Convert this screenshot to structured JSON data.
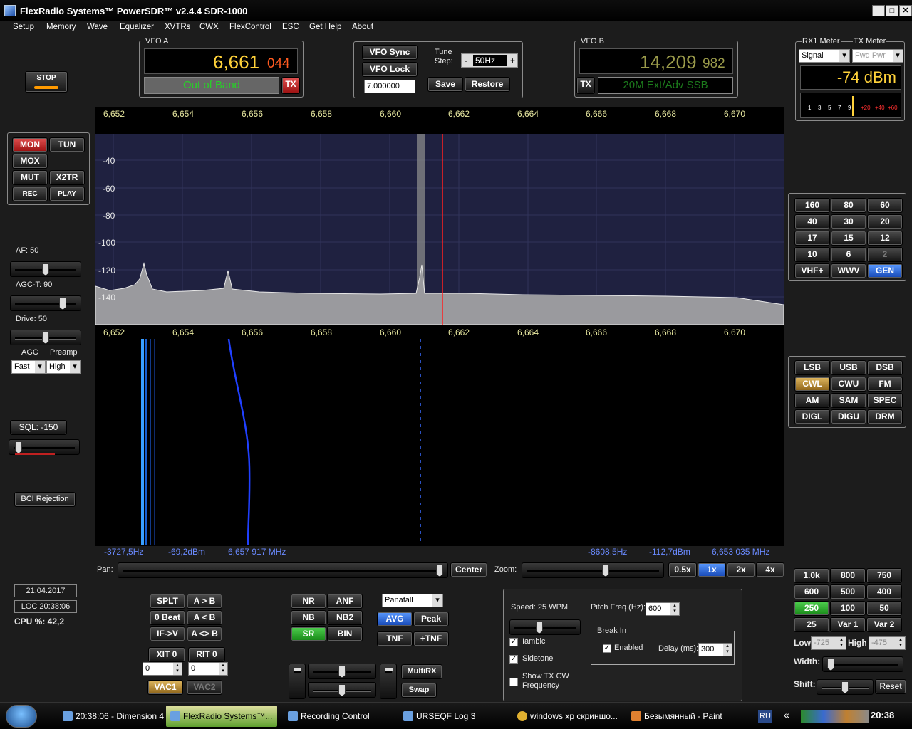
{
  "window": {
    "title": "FlexRadio Systems™  PowerSDR™  v2.4.4   SDR-1000"
  },
  "menu": [
    "Setup",
    "Memory",
    "Wave",
    "Equalizer",
    "XVTRs",
    "CWX",
    "FlexControl",
    "ESC",
    "Get Help",
    "About"
  ],
  "stop_label": "STOP",
  "vfo_a": {
    "label": "VFO A",
    "freq_main": "6,661",
    "freq_sub": "044",
    "band_status": "Out of Band",
    "tx_label": "TX"
  },
  "vfo_center": {
    "sync": "VFO Sync",
    "lock": "VFO Lock",
    "tune_label": "Tune\nStep:",
    "tune_value": "50Hz",
    "minus": "-",
    "plus": "+",
    "mem_freq": "7.000000",
    "save": "Save",
    "restore": "Restore"
  },
  "vfo_b": {
    "label": "VFO B",
    "freq_main": "14,209",
    "freq_sub": "982",
    "tx_label": "TX",
    "band_status": "20M Ext/Adv SSB"
  },
  "meter": {
    "rx_label": "RX1 Meter",
    "tx_label": "TX Meter",
    "rx_select": "Signal",
    "tx_select": "Fwd Pwr",
    "reading": "-74 dBm",
    "scale": [
      "1",
      "3",
      "5",
      "7",
      "9",
      "+20",
      "+40",
      "+60"
    ]
  },
  "left_buttons": {
    "mon": "MON",
    "tun": "TUN",
    "mox": "MOX",
    "mut": "MUT",
    "x2tr": "X2TR",
    "rec": "REC",
    "play": "PLAY"
  },
  "af_label": "AF:  50",
  "agct_label": "AGC-T:  90",
  "drive_label": "Drive:  50",
  "agc_label": "AGC",
  "preamp_label": "Preamp",
  "agc_value": "Fast",
  "preamp_value": "High",
  "sql_label": "SQL:  -150",
  "bci_label": "BCI Rejection",
  "date": "21.04.2017",
  "loc_time": "LOC 20:38:06",
  "cpu": "CPU %: 42,2",
  "freq_axis": [
    "6,652",
    "6,654",
    "6,656",
    "6,658",
    "6,660",
    "6,662",
    "6,664",
    "6,666",
    "6,668",
    "6,670"
  ],
  "db_axis": [
    "-40",
    "-60",
    "-80",
    "-100",
    "-120",
    "-140"
  ],
  "cursor_left": {
    "offset": "-3727,5Hz",
    "level": "-69,2dBm",
    "freq": "6,657 917 MHz"
  },
  "cursor_right": {
    "offset": "-8608,5Hz",
    "level": "-112,7dBm",
    "freq": "6,653 035 MHz"
  },
  "pan_label": "Pan:",
  "center_label": "Center",
  "zoom_label": "Zoom:",
  "zoom_buttons": [
    "0.5x",
    "1x",
    "2x",
    "4x"
  ],
  "bands": [
    "160",
    "80",
    "60",
    "40",
    "30",
    "20",
    "17",
    "15",
    "12",
    "10",
    "6",
    "2",
    "VHF+",
    "WWV",
    "GEN"
  ],
  "modes": [
    "LSB",
    "USB",
    "DSB",
    "CWL",
    "CWU",
    "FM",
    "AM",
    "SAM",
    "SPEC",
    "DIGL",
    "DIGU",
    "DRM"
  ],
  "filters": [
    "1.0k",
    "800",
    "750",
    "600",
    "500",
    "400",
    "250",
    "100",
    "50",
    "25",
    "Var 1",
    "Var 2"
  ],
  "filter_low_label": "Low",
  "filter_low": "-725",
  "filter_high_label": "High",
  "filter_high": "-475",
  "width_label": "Width:",
  "shift_label": "Shift:",
  "reset_label": "Reset",
  "bottom_left": {
    "splt": "SPLT",
    "atob": "A > B",
    "zerobeat": "0 Beat",
    "btoa": "A < B",
    "ifv": "IF->V",
    "swap_ab": "A <> B",
    "xit": "XIT",
    "xit_val": "0",
    "rit": "RIT",
    "rit_val": "0",
    "xit_field": "0",
    "rit_field": "0",
    "vac1": "VAC1",
    "vac2": "VAC2"
  },
  "dsp": {
    "nr": "NR",
    "anf": "ANF",
    "nb": "NB",
    "nb2": "NB2",
    "sr": "SR",
    "bin": "BIN",
    "display_mode": "Panafall",
    "avg": "AVG",
    "peak": "Peak",
    "tnf": "TNF",
    "plus_tnf": "+TNF"
  },
  "multirx": "MultiRX",
  "swap": "Swap",
  "cw": {
    "speed": "Speed:  25 WPM",
    "pitch_label": "Pitch Freq (Hz):",
    "pitch": "600",
    "iambic": "Iambic",
    "sidetone": "Sidetone",
    "show_tx": "Show TX CW\nFrequency",
    "breakin": "Break In",
    "enabled": "Enabled",
    "delay_label": "Delay (ms):",
    "delay": "300"
  },
  "taskbar": {
    "items": [
      "20:38:06 - Dimension 4",
      "FlexRadio Systems™...",
      "Recording Control",
      "URSEQF Log 3",
      "windows xp скриншо...",
      "Безымянный - Paint"
    ],
    "lang": "RU",
    "clock": "20:38"
  },
  "colors": {
    "accent_yellow": "#ffd23a",
    "vfo_a_sub": "#ff5a20",
    "band_green": "#28d028",
    "spectrum_bg": "#1f2140",
    "panel_bg": "#1c1c1c"
  }
}
